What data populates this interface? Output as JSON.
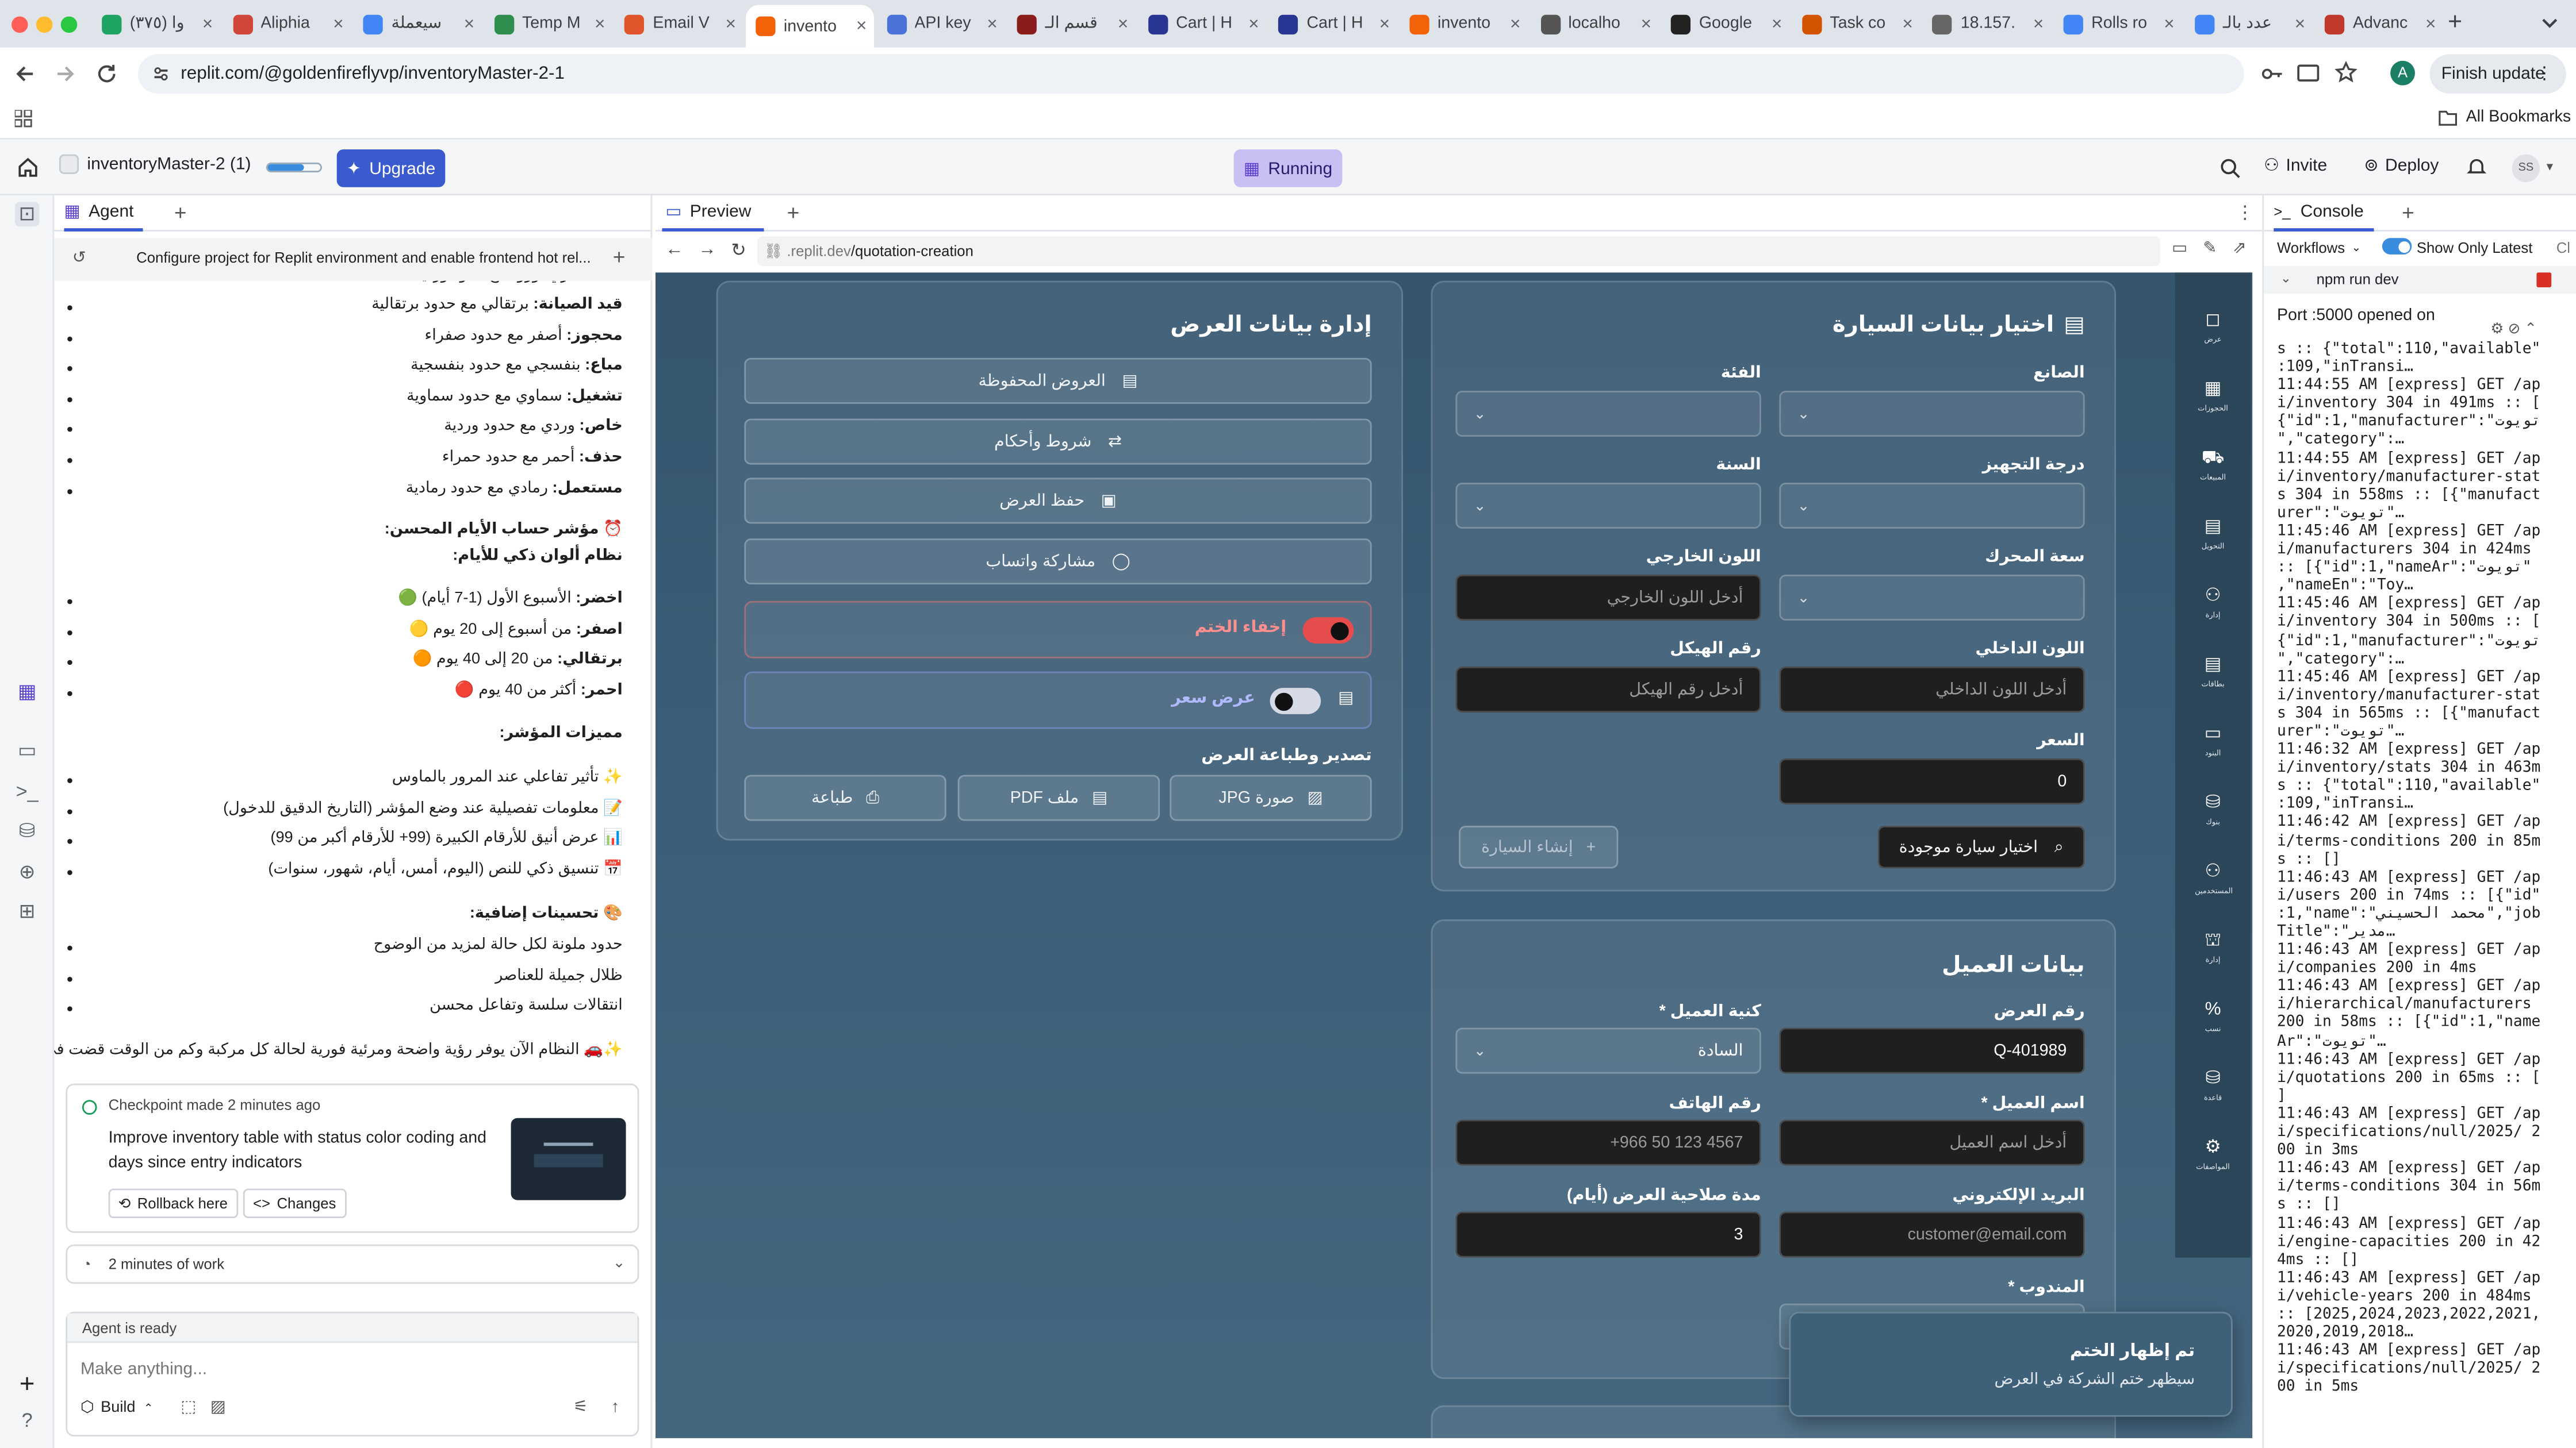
{
  "browser": {
    "tabs": [
      {
        "title": "(٣٧٥) وا",
        "color": "#1ea362"
      },
      {
        "title": "Aliphia",
        "color": "#d0463a"
      },
      {
        "title": "سيعملة",
        "color": "#4285f4"
      },
      {
        "title": "Temp M",
        "color": "#2f8d4e"
      },
      {
        "title": "Email V",
        "color": "#e0552b"
      },
      {
        "title": "invento",
        "color": "#f26207"
      },
      {
        "title": "API key",
        "color": "#4a72d9"
      },
      {
        "title": "قسم الـ",
        "color": "#8b1c1c"
      },
      {
        "title": "Cart | H",
        "color": "#283593"
      },
      {
        "title": "Cart | H",
        "color": "#283593"
      },
      {
        "title": "invento",
        "color": "#f26207"
      },
      {
        "title": "localho",
        "color": "#555555"
      },
      {
        "title": "Google",
        "color": "#222222"
      },
      {
        "title": "Task co",
        "color": "#d35400"
      },
      {
        "title": "18.157.",
        "color": "#666666"
      },
      {
        "title": "Rolls ro",
        "color": "#4285f4"
      },
      {
        "title": "عدد بالـ",
        "color": "#4285f4"
      },
      {
        "title": "Advanc",
        "color": "#c0392b"
      }
    ],
    "new_tab": "+",
    "url": "replit.com/@goldenfireflyvp/inventoryMaster-2-1",
    "finish_update": "Finish update",
    "profile_letter": "A",
    "all_bookmarks": "All Bookmarks"
  },
  "replit": {
    "repl_name": "inventoryMaster-2 (1)",
    "upgrade": "Upgrade",
    "running": "Running",
    "invite": "Invite",
    "deploy": "Deploy",
    "avatar": "SS"
  },
  "agent": {
    "tab": "Agent",
    "task": "Configure project for Replit environment and enable frontend hot rel...",
    "cut_line": "ـمـ السعري. ورود مع حدود وردية",
    "status_lines": [
      {
        "b": "قيد الصيانة:",
        "t": " برتقالي مع حدود برتقالية"
      },
      {
        "b": "محجوز:",
        "t": " أصفر مع حدود صفراء"
      },
      {
        "b": "مباع:",
        "t": " بنفسجي مع حدود بنفسجية"
      },
      {
        "b": "تشغيل:",
        "t": " سماوي مع حدود سماوية"
      },
      {
        "b": "خاص:",
        "t": " وردي مع حدود وردية"
      },
      {
        "b": "حذف:",
        "t": " أحمر مع حدود حمراء"
      },
      {
        "b": "مستعمل:",
        "t": " رمادي مع حدود رمادية"
      }
    ],
    "days_title": "⏰ مؤشر حساب الأيام المحسن:",
    "days_sub": "نظام ألوان ذكي للأيام:",
    "days_lines": [
      {
        "b": "اخضر:",
        "t": " الأسبوع الأول (1-7 أيام) 🟢"
      },
      {
        "b": "اصفر:",
        "t": " من أسبوع إلى 20 يوم 🟡"
      },
      {
        "b": "برتقالي:",
        "t": " من 20 إلى 40 يوم 🟠"
      },
      {
        "b": "احمر:",
        "t": " أكثر من 40 يوم 🔴"
      }
    ],
    "features_title": "مميزات المؤشر:",
    "feature_lines": [
      "✨ تأثير تفاعلي عند المرور بالماوس",
      "📝 معلومات تفصيلية عند وضع المؤشر (التاريخ الدقيق للدخول)",
      "📊 عرض أنيق للأرقام الكبيرة (99+ للأرقام أكبر من 99)",
      "📅 تنسيق ذكي للنص (اليوم، أمس، أيام، شهور، سنوات)"
    ],
    "extra_title": "🎨 تحسينات إضافية:",
    "extra_lines": [
      "حدود ملونة لكل حالة لمزيد من الوضوح",
      "ظلال جميلة للعناصر",
      "انتقالات سلسة وتفاعل محسن"
    ],
    "final_line": "✨🚗 النظام الآن يوفر رؤية واضحة ومرئية فورية لحالة كل مركبة وكم من الوقت قضت في المخزن!",
    "checkpoint_time": "Checkpoint made 2 minutes ago",
    "checkpoint_msg1": "Improve inventory table with status color coding and",
    "checkpoint_msg2": "days since entry indicators",
    "rollback": "Rollback here",
    "changes": "Changes",
    "work_time": "2 minutes of work",
    "ready": "Agent is ready",
    "placeholder": "Make anything...",
    "build": "Build"
  },
  "preview": {
    "tab": "Preview",
    "url_domain": ".replit.dev",
    "url_path": "/quotation-creation",
    "vehicle_card": {
      "title": "اختيار بيانات السيارة",
      "manufacturer": "الصانع",
      "category": "الفئة",
      "trim": "درجة التجهيز",
      "year": "السنة",
      "engine": "سعة المحرك",
      "ext_color": "اللون الخارجي",
      "ext_color_ph": "أدخل اللون الخارجي",
      "int_color": "اللون الداخلي",
      "int_color_ph": "أدخل اللون الداخلي",
      "chassis": "رقم الهيكل",
      "chassis_ph": "أدخل رقم الهيكل",
      "price": "السعر",
      "price_val": "0",
      "select_existing": "اختيار سيارة موجودة",
      "create_car": "إنشاء السيارة"
    },
    "quote_card": {
      "title": "إدارة بيانات العرض",
      "saved": "العروض المحفوظة",
      "terms": "شروط وأحكام",
      "save": "حفظ العرض",
      "whatsapp": "مشاركة واتساب",
      "hide_stamp": "إخفاء الختم",
      "hide_stamp_on": true,
      "price_offer": "عرض سعر",
      "price_offer_on": false,
      "export_title": "تصدير وطباعة العرض",
      "jpg": "صورة JPG",
      "pdf": "ملف PDF",
      "print": "طباعة"
    },
    "customer_card": {
      "title": "بيانات العميل",
      "quote_no": "رقم العرض",
      "quote_no_val": "Q-401989",
      "kunya": "كنية العميل *",
      "kunya_val": "السادة",
      "name": "اسم العميل *",
      "name_ph": "أدخل اسم العميل",
      "phone": "رقم الهاتف",
      "phone_ph": "+966 50 123 4567",
      "email": "البريد الإلكتروني",
      "email_ph": "customer@email.com",
      "validity": "مدة صلاحية العرض (أيام)",
      "validity_val": "3",
      "rep": "المندوب *"
    },
    "toast": {
      "title": "تم إظهار الختم",
      "body": "سيظهر ختم الشركة في العرض"
    },
    "sidenav": [
      "عرض",
      "الحجوزات",
      "المبيعات",
      "التحويل",
      "إدارة",
      "بطاقات",
      "البنود",
      "بنوك",
      "المستخدمين",
      "إدارة",
      "نسب",
      "قاعدة",
      "المواصفات"
    ]
  },
  "console": {
    "tab": "Console",
    "workflows": "Workflows",
    "show_latest": "Show Only Latest",
    "clear": "Cl",
    "process": "npm run dev",
    "port_line": "Port :5000 opened on",
    "logs": [
      "s :: {\"total\":110,\"available\"",
      ":109,\"inTransi…",
      "11:44:55 AM [express] GET /ap",
      "i/inventory 304 in 491ms :: [",
      "{\"id\":1,\"manufacturer\":\"تويوت",
      "\",\"category\":…",
      "11:44:55 AM [express] GET /ap",
      "i/inventory/manufacturer-stat",
      "s 304 in 558ms :: [{\"manufact",
      "urer\":\"تويوت\"…",
      "11:45:46 AM [express] GET /ap",
      "i/manufacturers 304 in 424ms",
      ":: [{\"id\":1,\"nameAr\":\"تويوت\"",
      ",\"nameEn\":\"Toy…",
      "11:45:46 AM [express] GET /ap",
      "i/inventory 304 in 500ms :: [",
      "{\"id\":1,\"manufacturer\":\"تويوت",
      "\",\"category\":…",
      "11:45:46 AM [express] GET /ap",
      "i/inventory/manufacturer-stat",
      "s 304 in 565ms :: [{\"manufact",
      "urer\":\"تويوت\"…",
      "11:46:32 AM [express] GET /ap",
      "i/inventory/stats 304 in 463m",
      "s :: {\"total\":110,\"available\"",
      ":109,\"inTransi…",
      "11:46:42 AM [express] GET /ap",
      "i/terms-conditions 200 in 85m",
      "s :: []",
      "11:46:43 AM [express] GET /ap",
      "i/users 200 in 74ms :: [{\"id\"",
      ":1,\"name\":\"محمد الحسيني\",\"job",
      "Title\":\"مدير…",
      "11:46:43 AM [express] GET /ap",
      "i/companies 200 in 4ms",
      "11:46:43 AM [express] GET /ap",
      "i/hierarchical/manufacturers",
      "200 in 58ms :: [{\"id\":1,\"name",
      "Ar\":\"تويوت\"…",
      "11:46:43 AM [express] GET /ap",
      "i/quotations 200 in 65ms :: [",
      "]",
      "11:46:43 AM [express] GET /ap",
      "i/specifications/null/2025/ 2",
      "00 in 3ms",
      "11:46:43 AM [express] GET /ap",
      "i/terms-conditions 304 in 56m",
      "s :: []",
      "11:46:43 AM [express] GET /ap",
      "i/engine-capacities 200 in 42",
      "4ms :: []",
      "11:46:43 AM [express] GET /ap",
      "i/vehicle-years 200 in 484ms",
      ":: [2025,2024,2023,2022,2021,",
      "2020,2019,2018…",
      "11:46:43 AM [express] GET /ap",
      "i/specifications/null/2025/ 2",
      "00 in 5ms"
    ]
  }
}
